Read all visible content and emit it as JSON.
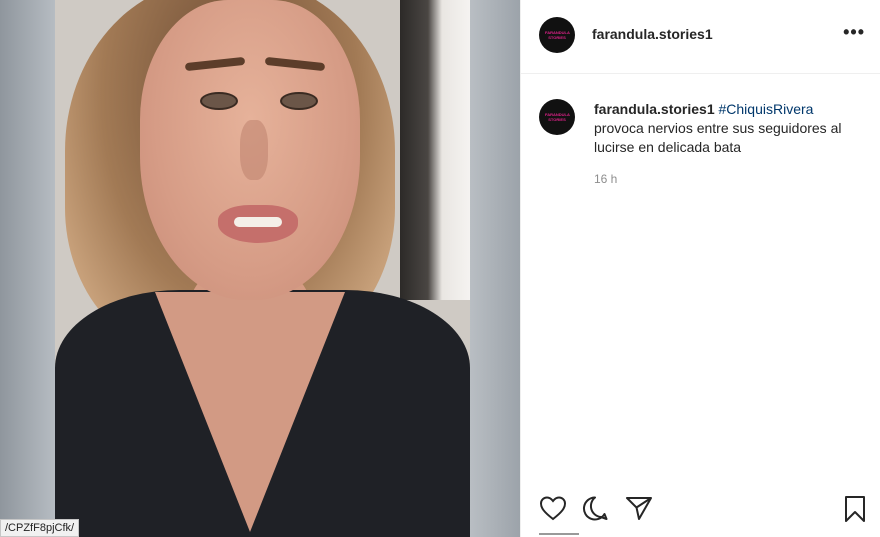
{
  "post": {
    "username": "farandula.stories1",
    "avatar_logo_text": "FARANDULA STORIES",
    "more_label": "•••",
    "caption_user": "farandula.stories1",
    "caption_hashtag": "#ChiquisRivera",
    "caption_text": "provoca nervios entre sus seguidores al lucirse en delicada bata",
    "time": "16 h"
  },
  "status_bar": {
    "url_tooltip": "/CPZfF8pjCfk/"
  },
  "icons": [
    "heart-icon",
    "comment-icon",
    "share-icon",
    "bookmark-icon",
    "more-icon"
  ],
  "colors": {
    "hashtag": "#00376b",
    "text": "#262626",
    "muted": "#8e8e8e",
    "avatar_logo": "#e0228a"
  }
}
